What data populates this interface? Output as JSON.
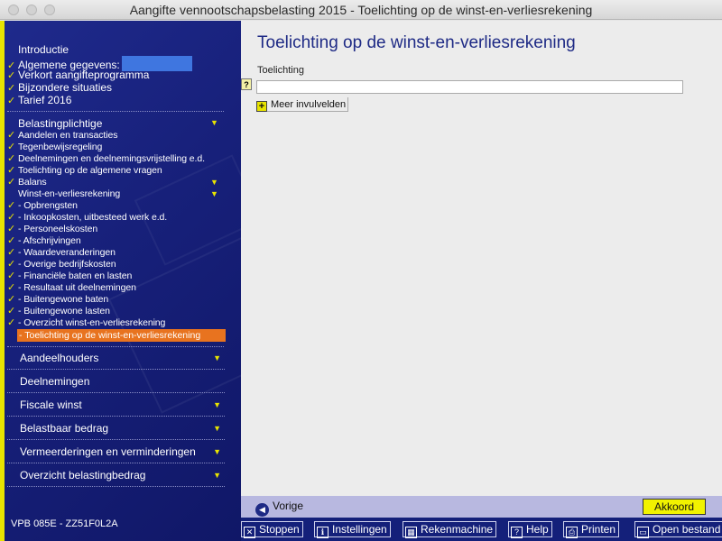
{
  "window": {
    "title": "Aangifte vennootschapsbelasting 2015 - Toelichting op de winst-en-verliesrekening"
  },
  "sidebar": {
    "top_items": [
      {
        "label": "Introductie",
        "checked": false
      },
      {
        "label": "Algemene gegevens:",
        "checked": true
      },
      {
        "label": "Verkort aangifteprogramma",
        "checked": true
      },
      {
        "label": "Bijzondere situaties",
        "checked": true
      },
      {
        "label": "Tarief 2016",
        "checked": true
      }
    ],
    "group_items": [
      {
        "label": "Belastingplichtige",
        "checked": false
      },
      {
        "label": "Aandelen en transacties",
        "checked": true
      },
      {
        "label": "Tegenbewijsregeling",
        "checked": true
      },
      {
        "label": "Deelnemingen en deelnemingsvrijstelling e.d.",
        "checked": true
      },
      {
        "label": "Toelichting op de algemene vragen",
        "checked": true
      },
      {
        "label": "Balans",
        "checked": true
      },
      {
        "label": "Winst-en-verliesrekening",
        "checked": false
      },
      {
        "label": "- Opbrengsten",
        "checked": true
      },
      {
        "label": "- Inkoopkosten, uitbesteed werk e.d.",
        "checked": true
      },
      {
        "label": "- Personeelskosten",
        "checked": true
      },
      {
        "label": "- Afschrijvingen",
        "checked": true
      },
      {
        "label": "- Waardeveranderingen",
        "checked": true
      },
      {
        "label": "- Overige bedrijfskosten",
        "checked": true
      },
      {
        "label": "- Financiële baten en lasten",
        "checked": true
      },
      {
        "label": "- Resultaat uit deelnemingen",
        "checked": true
      },
      {
        "label": "- Buitengewone baten",
        "checked": true
      },
      {
        "label": "- Buitengewone lasten",
        "checked": true
      },
      {
        "label": "- Overzicht winst-en-verliesrekening",
        "checked": true
      }
    ],
    "active_item": "- Toelichting op de winst-en-verliesrekening",
    "sections": [
      {
        "label": "Aandeelhouders",
        "has_arrow": true
      },
      {
        "label": "Deelnemingen",
        "has_arrow": false
      },
      {
        "label": "Fiscale winst",
        "has_arrow": true
      },
      {
        "label": "Belastbaar bedrag",
        "has_arrow": true
      },
      {
        "label": "Vermeerderingen en verminderingen",
        "has_arrow": true
      },
      {
        "label": "Overzicht belastingbedrag",
        "has_arrow": true
      }
    ],
    "version": "VPB 085E - ZZ51F0L2A"
  },
  "main": {
    "title": "Toelichting op de winst-en-verliesrekening",
    "field_label": "Toelichting",
    "field_value": "",
    "help_label": "?",
    "more_fields_label": "Meer invulvelden"
  },
  "nav": {
    "back_label": "Vorige",
    "submit_label": "Akkoord"
  },
  "toolbar": {
    "items": [
      {
        "label": "Stoppen",
        "icon": "stop-icon",
        "glyph": "✕"
      },
      {
        "label": "Instellingen",
        "icon": "settings-icon",
        "glyph": "ℹ"
      },
      {
        "label": "Rekenmachine",
        "icon": "calculator-icon",
        "glyph": "▦"
      },
      {
        "label": "Help",
        "icon": "help-icon",
        "glyph": "?"
      },
      {
        "label": "Printen",
        "icon": "printer-icon",
        "glyph": "⎙"
      },
      {
        "label": "Open bestand",
        "icon": "open-file-icon",
        "glyph": "▭"
      }
    ]
  },
  "colors": {
    "sidebar_bg": "#1a237e",
    "accent_yellow": "#e8e400",
    "active_orange": "#e8731f",
    "title_blue": "#1e2a85"
  }
}
